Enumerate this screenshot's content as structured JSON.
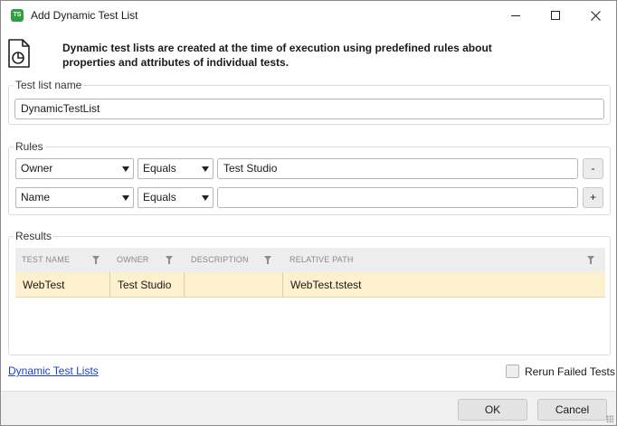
{
  "window": {
    "title": "Add Dynamic Test List",
    "app_icon_text": "TS"
  },
  "header": {
    "description": "Dynamic test lists are created at the time of execution using predefined rules about properties and attributes of individual tests."
  },
  "test_list_name": {
    "label": "Test list name",
    "value": "DynamicTestList"
  },
  "rules": {
    "label": "Rules",
    "items": [
      {
        "property": "Owner",
        "operator": "Equals",
        "value": "Test Studio",
        "button": "-"
      },
      {
        "property": "Name",
        "operator": "Equals",
        "value": "",
        "button": "+"
      }
    ]
  },
  "results": {
    "label": "Results",
    "columns": [
      "TEST NAME",
      "OWNER",
      "DESCRIPTION",
      "RELATIVE PATH"
    ],
    "rows": [
      {
        "test_name": "WebTest",
        "owner": "Test Studio",
        "description": "",
        "relative_path": "WebTest.tstest"
      }
    ]
  },
  "footer": {
    "help_link": "Dynamic Test Lists",
    "rerun_label": "Rerun Failed Tests",
    "rerun_checked": false,
    "ok_label": "OK",
    "cancel_label": "Cancel"
  },
  "colors": {
    "accent_green": "#2ea043",
    "row_highlight": "#fcf0cf",
    "link": "#1a3fd6"
  }
}
